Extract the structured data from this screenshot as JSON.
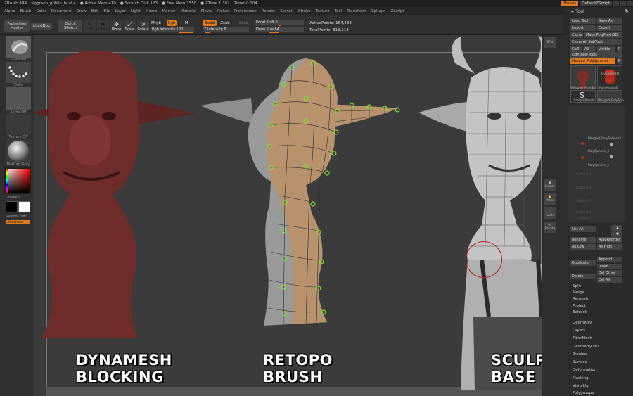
{
  "window": {
    "app": "ZBrush 4R4",
    "file": "siggraph_goblin_bust.4",
    "stats": [
      "● Active Mem 410",
      "● Scratch Disk 123",
      "● Free Mem 1550",
      "● ZTime 1.302",
      "Timer 0.004"
    ],
    "menus_btn": "Menus",
    "script_btn": "DefaultZScript"
  },
  "menu_bar": [
    "Alpha",
    "Brush",
    "Color",
    "Document",
    "Draw",
    "Edit",
    "File",
    "Layer",
    "Light",
    "Macro",
    "Marker",
    "Material",
    "Movie",
    "Picker",
    "Preferences",
    "Render",
    "Stencil",
    "Stroke",
    "Texture",
    "Tool",
    "Transform",
    "Zplugin",
    "Zscript"
  ],
  "toolbar": {
    "projection_master": "Projection Master",
    "lightbox": "LightBox",
    "quick_sketch": "Quick Sketch",
    "edit": "Edit",
    "draw": "Draw",
    "move": "Move",
    "scale": "Scale",
    "rotate": "Rotate",
    "mrgb": "Mrgb",
    "rgb": "Rgb",
    "m": "M",
    "rgb_intensity": "Rgb Intensity 100",
    "zadd": "Zadd",
    "zsub": "Zsub",
    "zcut": "Zcut",
    "z_intensity": "Z Intensity 6",
    "focal_shift": "Focal Shift 0",
    "draw_size": "Draw Size 64",
    "active_points": "ActivePoints: 154,488",
    "total_points": "TotalPoints: 313,212"
  },
  "left_shelf": {
    "brush_label": "Standard",
    "stroke_label": "Dots",
    "alpha_label": "Alpha Off",
    "texture_label": "Texture Off",
    "material_label": "MatCap Gray",
    "gradient": "Gradient",
    "switch_color": "SwitchColor",
    "alternate": "Alternate"
  },
  "right_shelf": [
    "SPix",
    "Frame",
    "Move",
    "Scale",
    "Rotate"
  ],
  "tool_panel": {
    "title": "Tool",
    "buttons": [
      [
        "Load Tool",
        "Save As"
      ],
      [
        "Import",
        "Export"
      ],
      [
        "Clone",
        "Make PolyMesh3D"
      ],
      [
        "Clone All SubTools"
      ],
      [
        "GoZ",
        "All",
        "Visible",
        "R"
      ],
      [
        "Lightbox›Tools"
      ],
      [
        "Merged_PolySphere2",
        "R"
      ]
    ],
    "thumbs": [
      "Merged_PolySp",
      "Cylinder3D",
      "PolyMesh3D",
      "SimpleBrush",
      "Merged_PolySph"
    ],
    "subtools": [
      "Merged_PolySphere2",
      "PolySphere_1",
      "PolySphere_1"
    ],
    "subtool_ghosts": [
      "Subtool 3",
      "Subtool 4",
      "Subtool 5",
      "Subtool 6",
      "Subtool 7"
    ],
    "list_all": "List All",
    "rename": "Rename",
    "auto_reorder": "AutoReorder",
    "all_low": "All Low",
    "all_high": "All High",
    "duplicate": "Duplicate",
    "append": "Append",
    "insert": "Insert",
    "delete": "Delete",
    "del_other": "Del Other",
    "del_all": "Del All",
    "sections": [
      "Split",
      "Merge",
      "Remesh",
      "Project",
      "Extract"
    ],
    "sub_palettes": [
      "Geometry",
      "Layers",
      "FiberMesh",
      "Geometry HD",
      "Preview",
      "Surface",
      "Deformation",
      "Masking",
      "Visibility",
      "Polygroups"
    ]
  },
  "captions": {
    "left": [
      "DYNAMESH",
      "BLOCKING"
    ],
    "middle": [
      "RETOPO",
      "BRUSH"
    ],
    "right": [
      "SCULPTED",
      "BASE MESH"
    ]
  },
  "colors": {
    "accent": "#e07b1f",
    "left_model": "#6e2c2a",
    "mid_model_gray": "#9a9a9a",
    "mid_model_tan": "#b8926c",
    "retopo_points": "#7be030",
    "right_model": "#b4b4b4"
  }
}
